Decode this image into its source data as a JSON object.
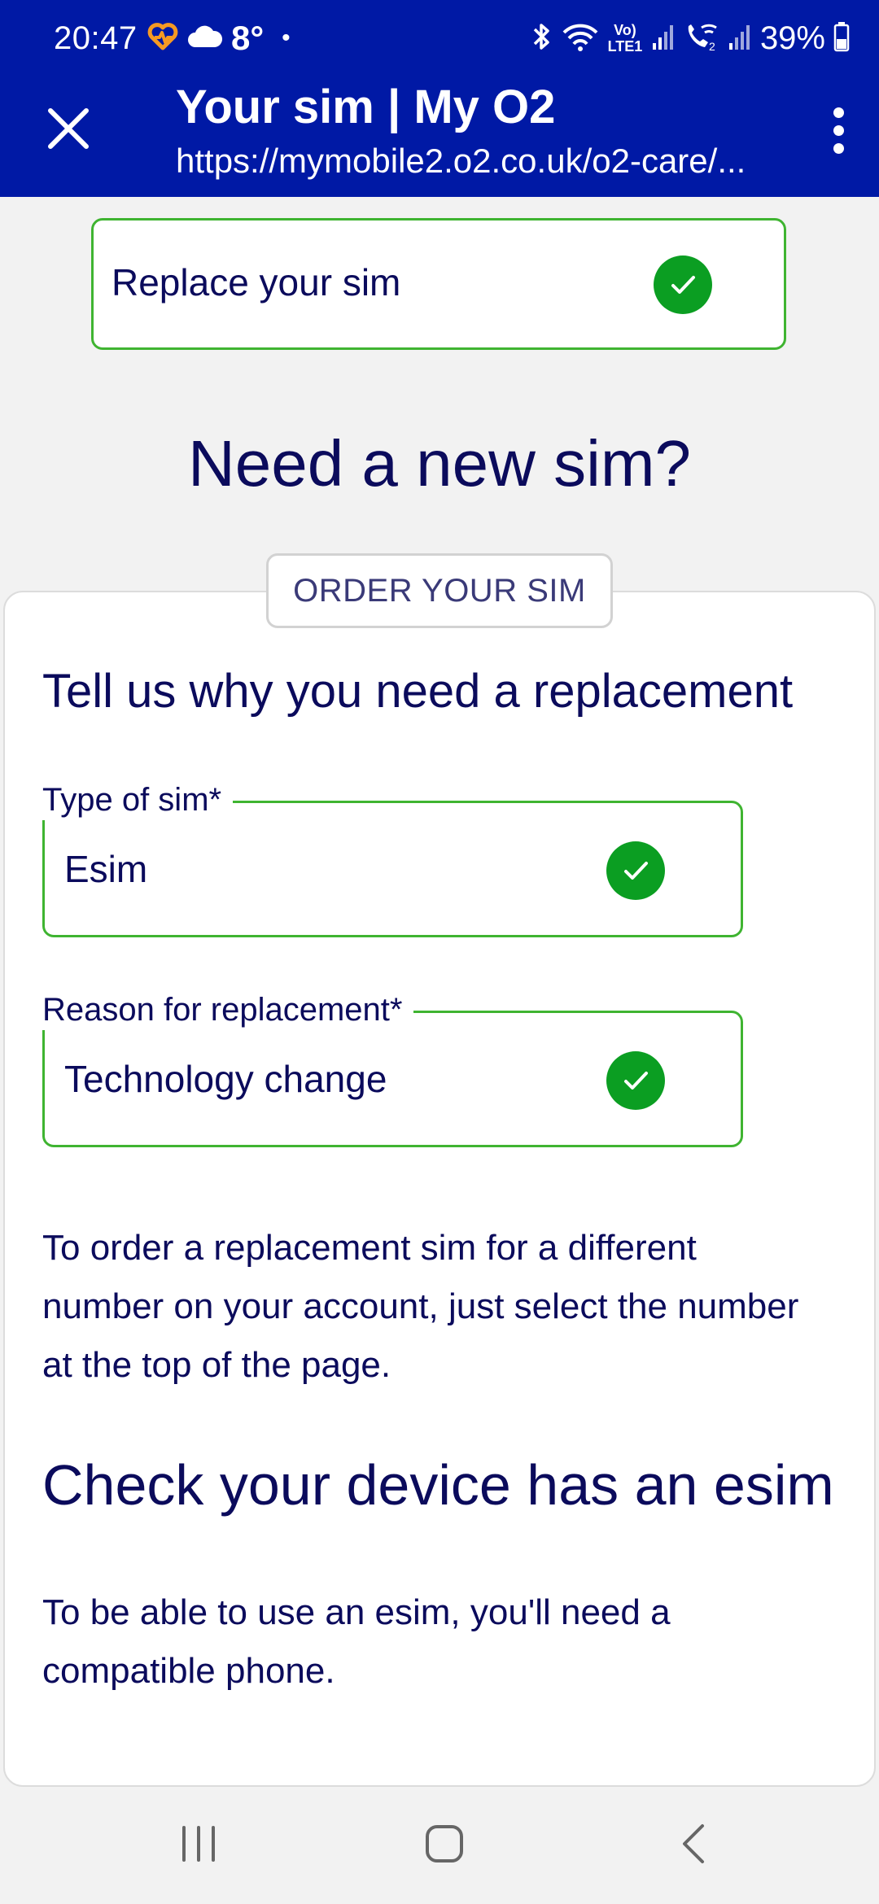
{
  "status_bar": {
    "time": "20:47",
    "temperature": "8°",
    "notification_dot": "•",
    "network_text": "Vo) LTE1",
    "battery_percent": "39%",
    "icons": [
      "heart-rate-icon",
      "cloud-icon",
      "bluetooth-icon",
      "wifi-icon",
      "signal-icon",
      "wifi-calling-icon",
      "signal-icon",
      "battery-icon"
    ]
  },
  "browser": {
    "title": "Your sim | My O2",
    "url": "https://mymobile2.o2.co.uk/o2-care/...",
    "close_icon": "close-icon",
    "menu_icon": "more-vertical-icon"
  },
  "replace_step": {
    "label": "Replace your sim",
    "status_icon": "check-circle-icon"
  },
  "page": {
    "heading": "Need a new sim?",
    "order_chip": "ORDER YOUR SIM",
    "section_heading": "Tell us why you need a replacement",
    "fields": [
      {
        "label": "Type of sim*",
        "value": "Esim"
      },
      {
        "label": "Reason for replacement*",
        "value": "Technology change"
      }
    ],
    "info_text": "To order a replacement sim for a different number on your account, just select the number at the top of the page.",
    "esim_heading": "Check your device has an esim",
    "esim_text": "To be able to use an esim, you'll need a compatible phone."
  },
  "navigation": {
    "icons": [
      "recent-apps-icon",
      "home-icon",
      "back-icon"
    ]
  },
  "colors": {
    "header_blue": "#0019a5",
    "text_navy": "#0b0b5c",
    "success_border": "#3fb431",
    "success_check": "#0b9e22",
    "background": "#f2f2f2"
  }
}
